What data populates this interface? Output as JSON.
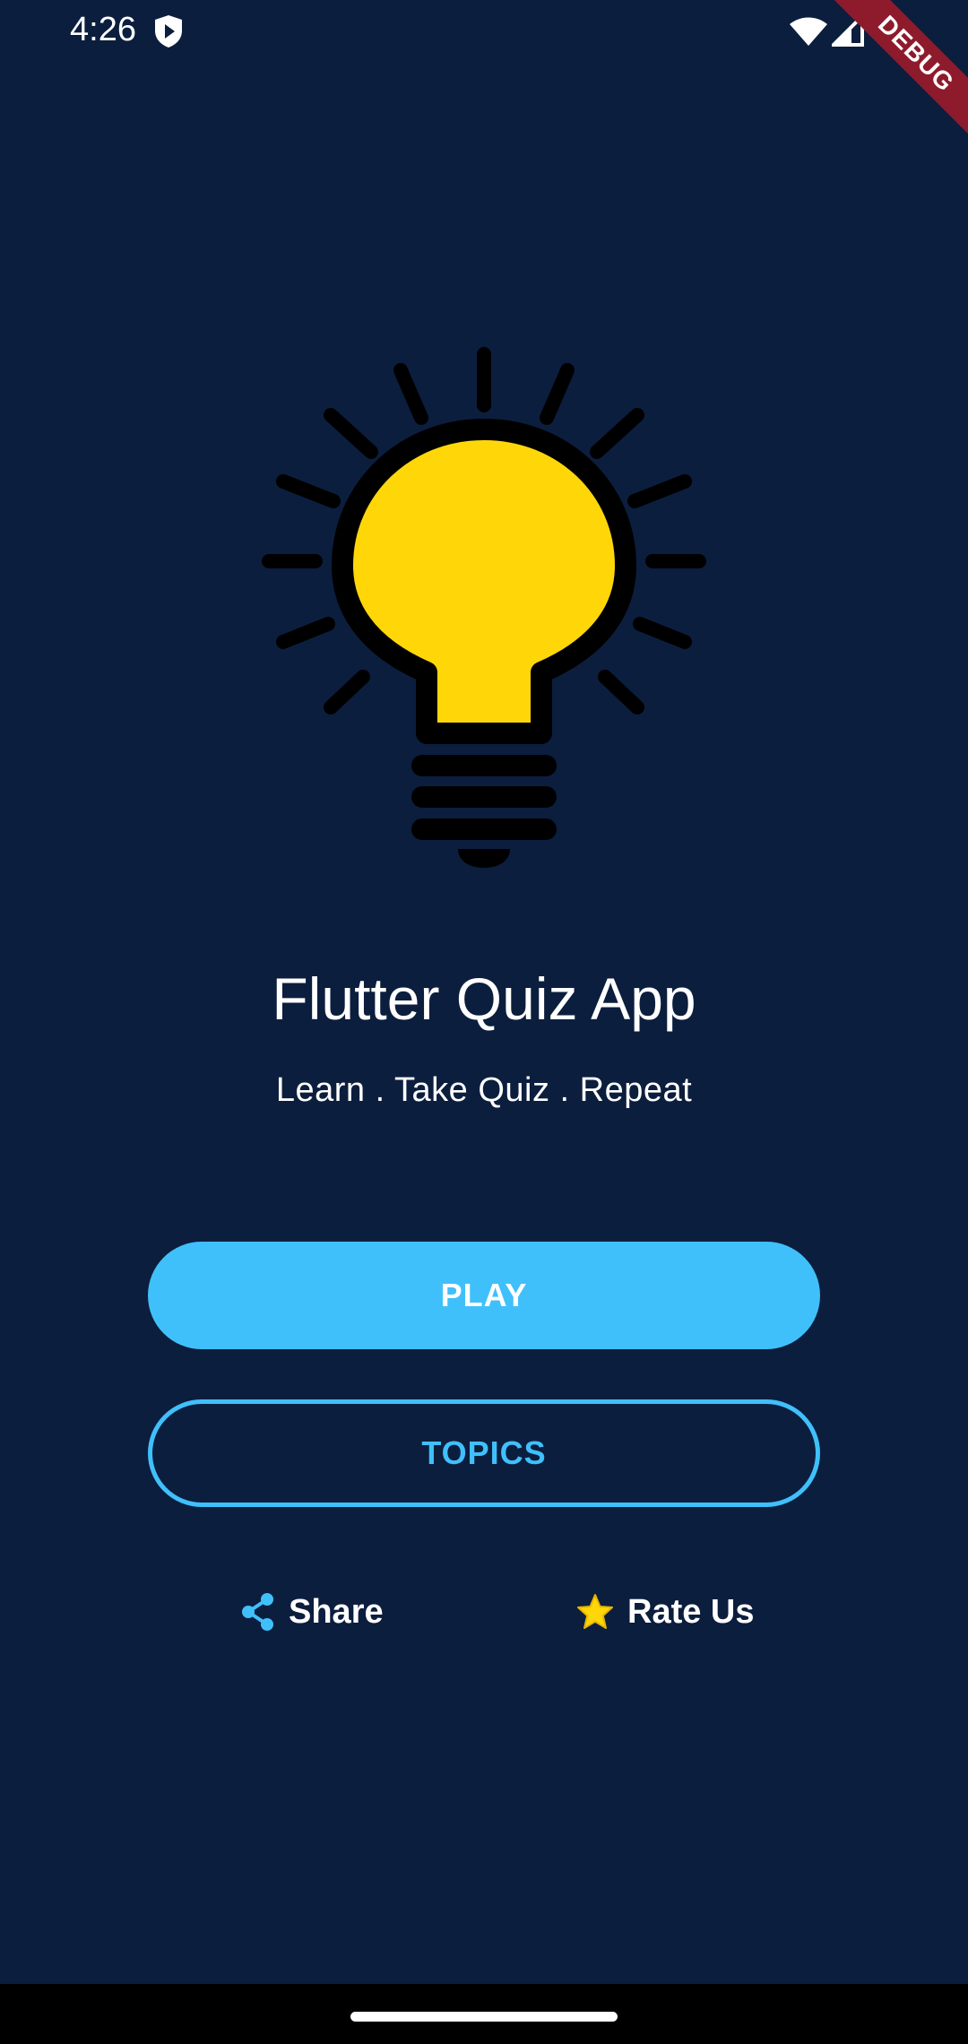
{
  "status_bar": {
    "time": "4:26"
  },
  "debug_banner": {
    "label": "DEBUG"
  },
  "hero": {
    "icon": "lightbulb-icon",
    "bulb_color": "#ffd709"
  },
  "app": {
    "title": "Flutter Quiz App",
    "tagline": "Learn . Take Quiz . Repeat"
  },
  "buttons": {
    "play_label": "PLAY",
    "topics_label": "TOPICS"
  },
  "links": {
    "share_label": "Share",
    "share_icon": "share-icon",
    "rate_label": "Rate Us",
    "rate_icon": "star-icon"
  },
  "colors": {
    "background": "#0c1e3e",
    "accent": "#40c0fb",
    "star": "#ffd709",
    "debug": "#8e1b2c"
  }
}
